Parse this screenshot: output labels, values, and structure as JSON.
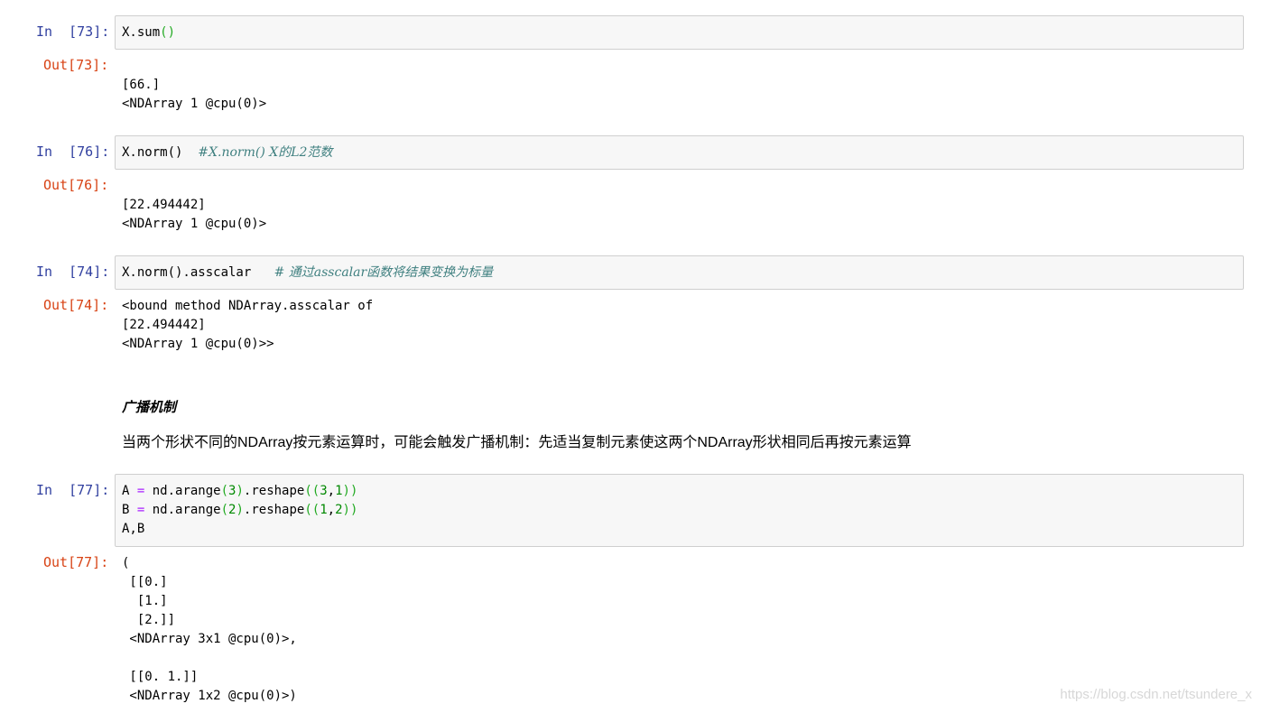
{
  "cells": [
    {
      "in_prompt": "In  [73]:",
      "code": [
        "X.sum()"
      ],
      "out_prompt": "Out[73]:",
      "output": "[66.]\n<NDArray 1 @cpu(0)>"
    },
    {
      "in_prompt": "In  [76]:",
      "code": [
        "X.norm()"
      ],
      "comment": "#X.norm() X的L2范数",
      "out_prompt": "Out[76]:",
      "output": "[22.494442]\n<NDArray 1 @cpu(0)>"
    },
    {
      "in_prompt": "In  [74]:",
      "code": [
        "X.norm().asscalar"
      ],
      "comment": "# 通过asscalar函数将结果变换为标量",
      "out_prompt": "Out[74]:",
      "output": "<bound method NDArray.asscalar of \n[22.494442]\n<NDArray 1 @cpu(0)>>"
    },
    {
      "in_prompt": "In  [77]:",
      "code": [
        "A = nd.arange(3).reshape((3,1))",
        "B = nd.arange(2).reshape((1,2))",
        "A,B"
      ],
      "out_prompt": "Out[77]:",
      "output": "(\n [[0.]\n  [1.]\n  [2.]]\n <NDArray 3x1 @cpu(0)>, \n \n [[0. 1.]]\n <NDArray 1x2 @cpu(0)>)"
    }
  ],
  "markdown": {
    "title": "广播机制",
    "text": "当两个形状不同的NDArray按元素运算时，可能会触发广播机制：先适当复制元素使这两个NDArray形状相同后再按元素运算"
  },
  "watermark": "https://blog.csdn.net/tsundere_x"
}
